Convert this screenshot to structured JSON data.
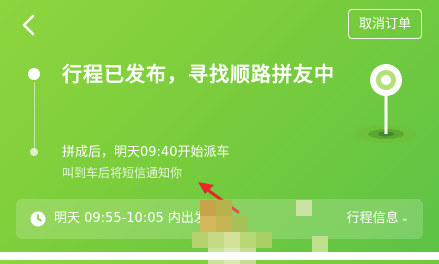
{
  "header": {
    "back_icon": "chevron-left-icon",
    "cancel_label": "取消订单"
  },
  "status": {
    "title": "行程已发布，寻找顺路拼友中",
    "dispatch_text": "拼成后，明天09:40开始派车",
    "notify_text": "叫到车后将短信通知你"
  },
  "trip_bar": {
    "icon": "clock-icon",
    "time_text": "明天 09:55-10:05 内出发",
    "info_label": "行程信息",
    "info_icon": "chevron-down-icon"
  },
  "colors": {
    "background_start": "#8ed53f",
    "background_end": "#5cc347",
    "annotation_arrow": "#e8262b"
  }
}
